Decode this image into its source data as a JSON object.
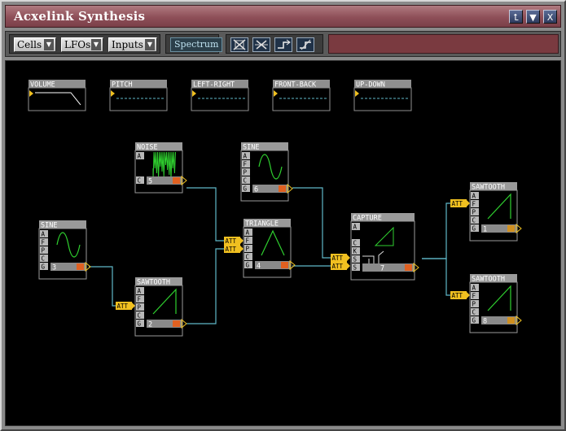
{
  "window": {
    "title": "Acxelink Synthesis"
  },
  "titlebar_buttons": [
    "restore-icon",
    "minimize-icon",
    "close-icon"
  ],
  "toolbar": {
    "dropdowns": [
      "Cells",
      "LFOs",
      "Inputs"
    ],
    "spectrum_label": "Spectrum",
    "tool_icons": [
      "delete-cell-icon",
      "delete-link-icon",
      "connect-icon",
      "disconnect-icon"
    ]
  },
  "colors": {
    "title_bg": "#8e4f58",
    "canvas_bg": "#000000",
    "wire": "#5fb8c8",
    "att": "#f0c020",
    "plot": "#2fd02f",
    "port_x": "#e06020"
  },
  "env_cells": [
    {
      "label": "VOLUME"
    },
    {
      "label": "PITCH"
    },
    {
      "label": "LEFT-RIGHT"
    },
    {
      "label": "FRONT-BACK"
    },
    {
      "label": "UP-DOWN"
    }
  ],
  "cells": [
    {
      "id": "noise",
      "label": "NOISE",
      "num": "5",
      "ports": [
        "A",
        "",
        "",
        "C"
      ]
    },
    {
      "id": "sine2",
      "label": "SINE",
      "num": "6",
      "ports": [
        "A",
        "F",
        "P",
        "C",
        "G"
      ]
    },
    {
      "id": "sine1",
      "label": "SINE",
      "num": "3",
      "ports": [
        "A",
        "F",
        "P",
        "C",
        "G"
      ]
    },
    {
      "id": "triangle",
      "label": "TRIANGLE",
      "num": "4",
      "ports": [
        "A",
        "F",
        "P",
        "C",
        "G"
      ]
    },
    {
      "id": "saw1",
      "label": "SAWTOOTH",
      "num": "2",
      "ports": [
        "A",
        "F",
        "P",
        "C",
        "G"
      ]
    },
    {
      "id": "capture",
      "label": "CAPTURE",
      "num": "7",
      "ports": [
        "A",
        "",
        "C",
        "K",
        "S",
        "S"
      ]
    },
    {
      "id": "saw2",
      "label": "SAWTOOTH",
      "num": "1",
      "ports": [
        "A",
        "F",
        "P",
        "C",
        "G"
      ]
    },
    {
      "id": "saw3",
      "label": "SAWTOOTH",
      "num": "8",
      "ports": [
        "A",
        "F",
        "P",
        "C",
        "G"
      ]
    }
  ],
  "att_label": "ATT"
}
